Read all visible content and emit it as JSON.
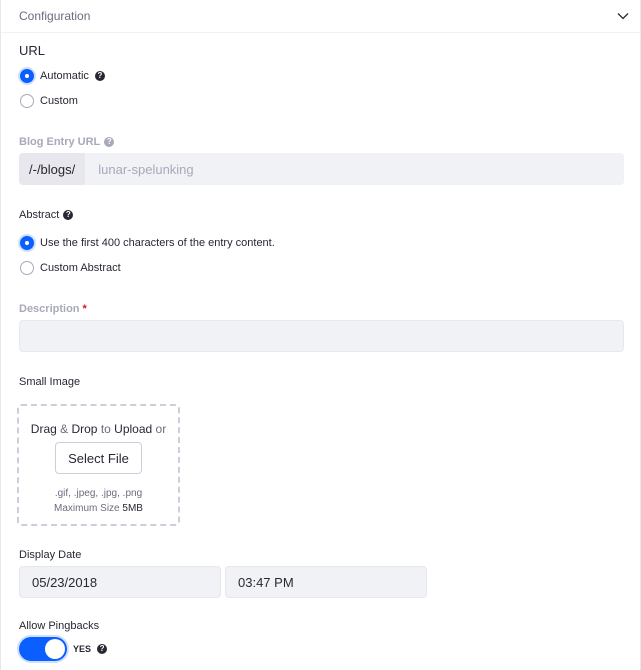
{
  "panel": {
    "title": "Configuration"
  },
  "url": {
    "heading": "URL",
    "options": [
      {
        "label": "Automatic",
        "checked": true
      },
      {
        "label": "Custom",
        "checked": false
      }
    ]
  },
  "blog_entry_url": {
    "label": "Blog Entry URL",
    "prefix": "/-/blogs/",
    "value": "",
    "placeholder": "lunar-spelunking"
  },
  "abstract": {
    "label": "Abstract",
    "options": [
      {
        "label": "Use the first 400 characters of the entry content.",
        "checked": true
      },
      {
        "label": "Custom Abstract",
        "checked": false
      }
    ]
  },
  "description": {
    "label": "Description",
    "required_mark": "*",
    "value": ""
  },
  "small_image": {
    "label": "Small Image",
    "drag": "Drag",
    "amp": " & ",
    "drop": "Drop",
    "to": " to ",
    "upload": "Upload",
    "or": " or",
    "select_button": "Select File",
    "formats": ".gif, .jpeg, .jpg, .png",
    "max_size_label": "Maximum Size ",
    "max_size_value": "5MB"
  },
  "display_date": {
    "label": "Display Date",
    "date": "05/23/2018",
    "time": "03:47 PM"
  },
  "pingbacks": {
    "label": "Allow Pingbacks",
    "state_label": "YES",
    "enabled": true
  },
  "colors": {
    "accent": "#0b5fff",
    "field_bg": "#f1f2f5",
    "muted_text": "#a7a9bc"
  },
  "icons": {
    "collapse": "chevron-down-icon",
    "help": "question-circle-icon"
  }
}
